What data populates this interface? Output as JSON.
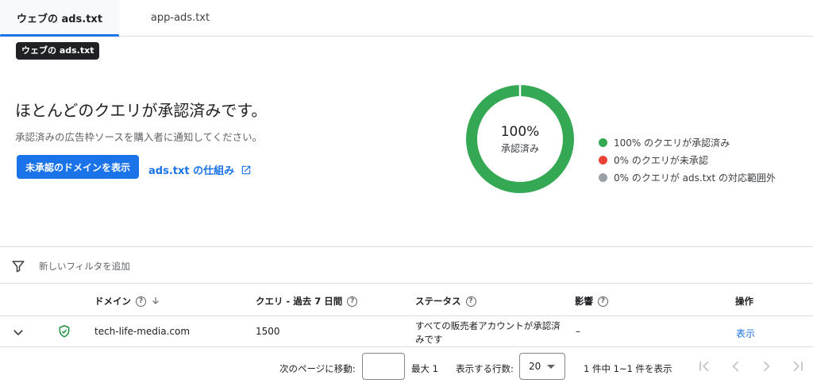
{
  "tabs": [
    {
      "label": "ウェブの ads.txt",
      "active": true
    },
    {
      "label": "app-ads.txt",
      "active": false
    }
  ],
  "tooltip": "ウェブの ads.txt",
  "summary": {
    "headline": "ほとんどのクエリが承認済みです。",
    "subtext": "承認済みの広告枠ソースを購入者に通知してください。",
    "primary_button": "未承認のドメインを表示",
    "link_label": "ads.txt の仕組み",
    "link_icon": "open-in-new-icon"
  },
  "donut": {
    "value": "100%",
    "label": "承認済み",
    "approved_fraction": 1.0,
    "colors": {
      "approved": "#34a853",
      "unapproved": "#ea4335",
      "out_of_scope": "#9aa0a6"
    }
  },
  "legend": [
    {
      "label": "100% のクエリが承認済み",
      "color": "#34a853"
    },
    {
      "label": "0% のクエリが未承認",
      "color": "#ea4335"
    },
    {
      "label": "0% のクエリが ads.txt の対応範囲外",
      "color": "#9aa0a6"
    }
  ],
  "filter": {
    "placeholder": "新しいフィルタを追加",
    "icon": "filter-icon"
  },
  "table": {
    "headers": {
      "domain": "ドメイン",
      "queries": "クエリ - 過去 7 日間",
      "status": "ステータス",
      "impact": "影響",
      "action": "操作"
    },
    "rows": [
      {
        "domain": "tech-life-media.com",
        "queries": "1500",
        "status": "すべての販売者アカウントが承認済みです",
        "impact": "–",
        "action": "表示"
      }
    ]
  },
  "pagination": {
    "goto_label": "次のページに移動:",
    "goto_value": "",
    "max_label": "最大 1",
    "rows_label": "表示する行数:",
    "rows_value": "20",
    "range_label": "1 件中 1~1 件を表示"
  }
}
